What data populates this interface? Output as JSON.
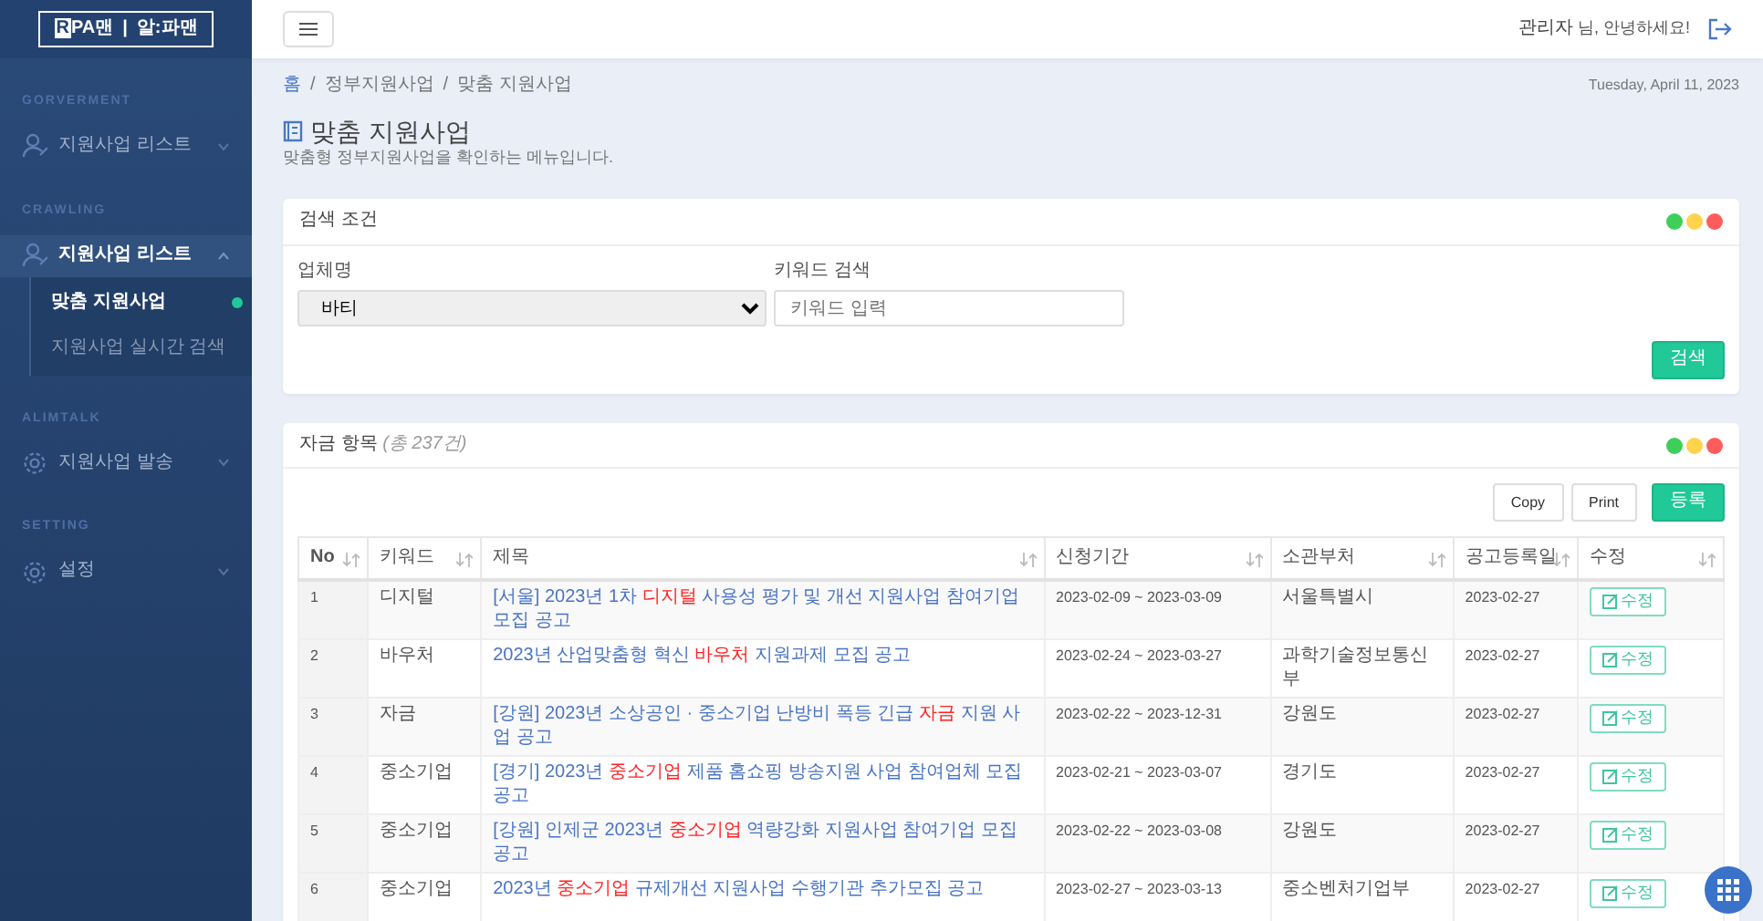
{
  "sidebar": {
    "logo": {
      "mark": "R",
      "text": "PA맨",
      "separator": "|",
      "text2": "알:파맨"
    },
    "sections": [
      {
        "label": "GORVERMENT",
        "items": [
          {
            "label": "지원사업 리스트",
            "expanded": false
          }
        ]
      },
      {
        "label": "CRAWLING",
        "items": [
          {
            "label": "지원사업 리스트",
            "expanded": true,
            "children": [
              {
                "label": "맞춤 지원사업",
                "selected": true
              },
              {
                "label": "지원사업 실시간 검색",
                "selected": false
              }
            ]
          }
        ]
      },
      {
        "label": "ALIMTALK",
        "items": [
          {
            "label": "지원사업 발송",
            "expanded": false
          }
        ]
      },
      {
        "label": "SETTING",
        "items": [
          {
            "label": "설정",
            "expanded": false
          }
        ]
      }
    ]
  },
  "header": {
    "user": "관리자",
    "greeting": "님, 안녕하세요!"
  },
  "breadcrumb": {
    "separator": "/",
    "items": [
      "홈",
      "정부지원사업",
      "맞춤 지원사업"
    ]
  },
  "date": "Tuesday, April 11, 2023",
  "page": {
    "title": "맞춤 지원사업",
    "subtitle": "맞춤형 정부지원사업을 확인하는 메뉴입니다."
  },
  "search_card": {
    "title": "검색 조건",
    "company": {
      "label": "업체명",
      "value": "바티"
    },
    "keyword": {
      "label": "키워드 검색",
      "placeholder": "키워드 입력"
    },
    "button": "검색"
  },
  "list_card": {
    "title": "자금 항목",
    "count": "(총 237건)",
    "buttons": [
      {
        "label": "Copy",
        "kind": "plain"
      },
      {
        "label": "Print",
        "kind": "plain"
      },
      {
        "label": "등록",
        "kind": "primary"
      }
    ],
    "table": {
      "columns": [
        "No",
        "키워드",
        "제목",
        "신청기간",
        "소관부처",
        "공고등록일",
        "수정"
      ],
      "rows": [
        {
          "no": "1",
          "keyword": "디지털",
          "title": {
            "before": "[서울] 2023년 1차 ",
            "keyword": "디지털",
            "after": " 사용성 평가 및 개선 지원사업 참여기업 모집 공고"
          },
          "period": "2023-02-09 ~ 2023-03-09",
          "ministry": "서울특별시",
          "date": "2023-02-27",
          "edit": "수정"
        },
        {
          "no": "2",
          "keyword": "바우처",
          "title": {
            "before": "2023년 산업맞춤형 혁신 ",
            "keyword": "바우처",
            "after": " 지원과제 모집 공고"
          },
          "period": "2023-02-24 ~ 2023-03-27",
          "ministry": "과학기술정보통신부",
          "date": "2023-02-27",
          "edit": "수정"
        },
        {
          "no": "3",
          "keyword": "자금",
          "title": {
            "before": "[강원] 2023년 소상공인 · 중소기업 난방비 폭등 긴급 ",
            "keyword": "자금",
            "after": " 지원 사업 공고"
          },
          "period": "2023-02-22 ~ 2023-12-31",
          "ministry": "강원도",
          "date": "2023-02-27",
          "edit": "수정"
        },
        {
          "no": "4",
          "keyword": "중소기업",
          "title": {
            "before": "[경기] 2023년 ",
            "keyword": "중소기업",
            "after": " 제품 홈쇼핑 방송지원 사업 참여업체 모집 공고"
          },
          "period": "2023-02-21 ~ 2023-03-07",
          "ministry": "경기도",
          "date": "2023-02-27",
          "edit": "수정"
        },
        {
          "no": "5",
          "keyword": "중소기업",
          "title": {
            "before": "[강원] 인제군 2023년 ",
            "keyword": "중소기업",
            "after": " 역량강화 지원사업 참여기업 모집 공고"
          },
          "period": "2023-02-22 ~ 2023-03-08",
          "ministry": "강원도",
          "date": "2023-02-27",
          "edit": "수정"
        },
        {
          "no": "6",
          "keyword": "중소기업",
          "title": {
            "before": "2023년 ",
            "keyword": "중소기업",
            "after": " 규제개선 지원사업 수행기관 추가모집 공고"
          },
          "period": "2023-02-27 ~ 2023-03-13",
          "ministry": "중소벤처기업부",
          "date": "2023-02-27",
          "edit": "수정"
        }
      ]
    }
  }
}
